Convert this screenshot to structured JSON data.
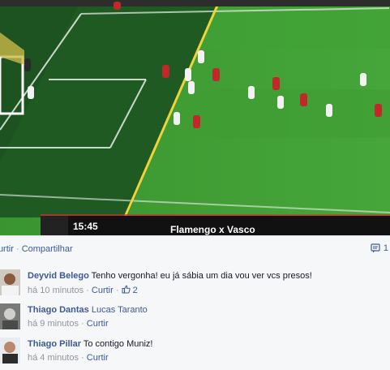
{
  "photo": {
    "scoreboard_time": "15:45",
    "caption": "Flamengo x Vasco"
  },
  "actions": {
    "like_label": "Curtir",
    "separator": "·",
    "share_label": "Compartilhar",
    "comment_count": "1",
    "comment_icon": "comment-icon"
  },
  "comments": [
    {
      "author": "Deyvid Belego",
      "text": "Tenho vergonha! eu já sábia um dia vou ver vcs presos!",
      "time": "há 10 minutos",
      "like_label": "Curtir",
      "likes": "2",
      "like_icon": "thumbs-up-icon"
    },
    {
      "author": "Thiago Dantas",
      "text": "Lucas Taranto",
      "time": "há 9 minutos",
      "like_label": "Curtir"
    },
    {
      "author": "Thiago Pillar",
      "text": "To contigo Muniz!",
      "time": "há 4 minutos",
      "like_label": "Curtir"
    }
  ],
  "colors": {
    "link": "#3b5998",
    "meta": "#90949c",
    "pitch_dark": "#1f5a23",
    "pitch_light": "#3d9a2e",
    "offside_line": "#f0d23a"
  }
}
